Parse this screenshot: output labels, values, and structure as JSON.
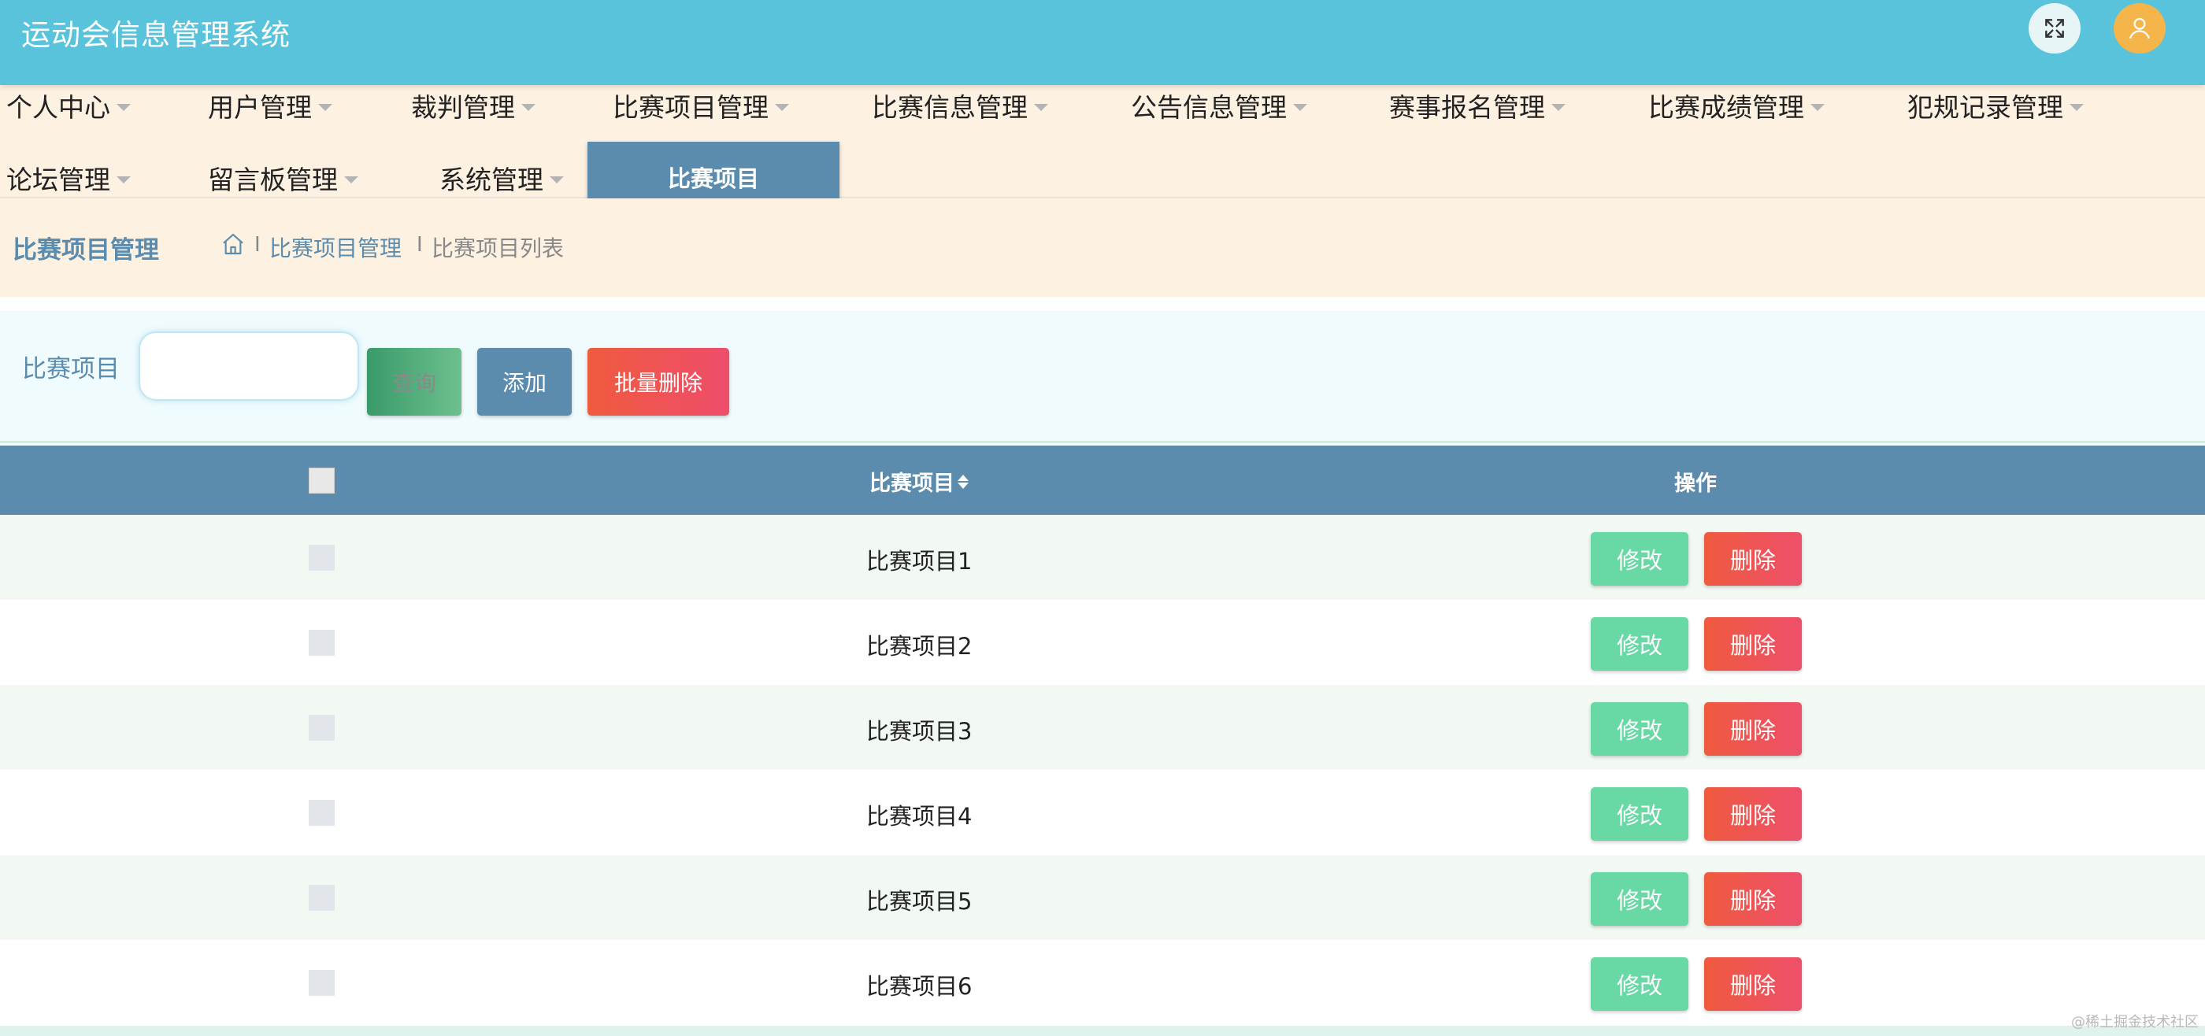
{
  "header": {
    "title": "运动会信息管理系统",
    "fullscreen_icon": "expand-arrows-icon",
    "avatar_icon": "user-icon"
  },
  "nav": {
    "row1": [
      "个人中心",
      "用户管理",
      "裁判管理",
      "比赛项目管理",
      "比赛信息管理",
      "公告信息管理",
      "赛事报名管理",
      "比赛成绩管理",
      "犯规记录管理"
    ],
    "row2": [
      "论坛管理",
      "留言板管理",
      "系统管理"
    ],
    "active_tab": "比赛项目"
  },
  "breadcrumb": {
    "page_title": "比赛项目管理",
    "home_icon": "home-icon",
    "separator": "I",
    "link": "比赛项目管理",
    "current": "比赛项目列表"
  },
  "search": {
    "label": "比赛项目",
    "value": "",
    "placeholder": "",
    "query_label": "查询",
    "add_label": "添加",
    "batch_delete_label": "批量删除"
  },
  "table": {
    "columns": {
      "name": "比赛项目",
      "actions": "操作"
    },
    "rows": [
      {
        "name": "比赛项目1"
      },
      {
        "name": "比赛项目2"
      },
      {
        "name": "比赛项目3"
      },
      {
        "name": "比赛项目4"
      },
      {
        "name": "比赛项目5"
      },
      {
        "name": "比赛项目6"
      }
    ],
    "edit_label": "修改",
    "delete_label": "删除"
  },
  "watermark": "@稀土掘金技术社区",
  "colors": {
    "header": "#58c3db",
    "nav_bg": "#fdf1e2",
    "accent": "#5b8bad",
    "edit": "#68d8a4",
    "delete": "#ef5a3e"
  }
}
